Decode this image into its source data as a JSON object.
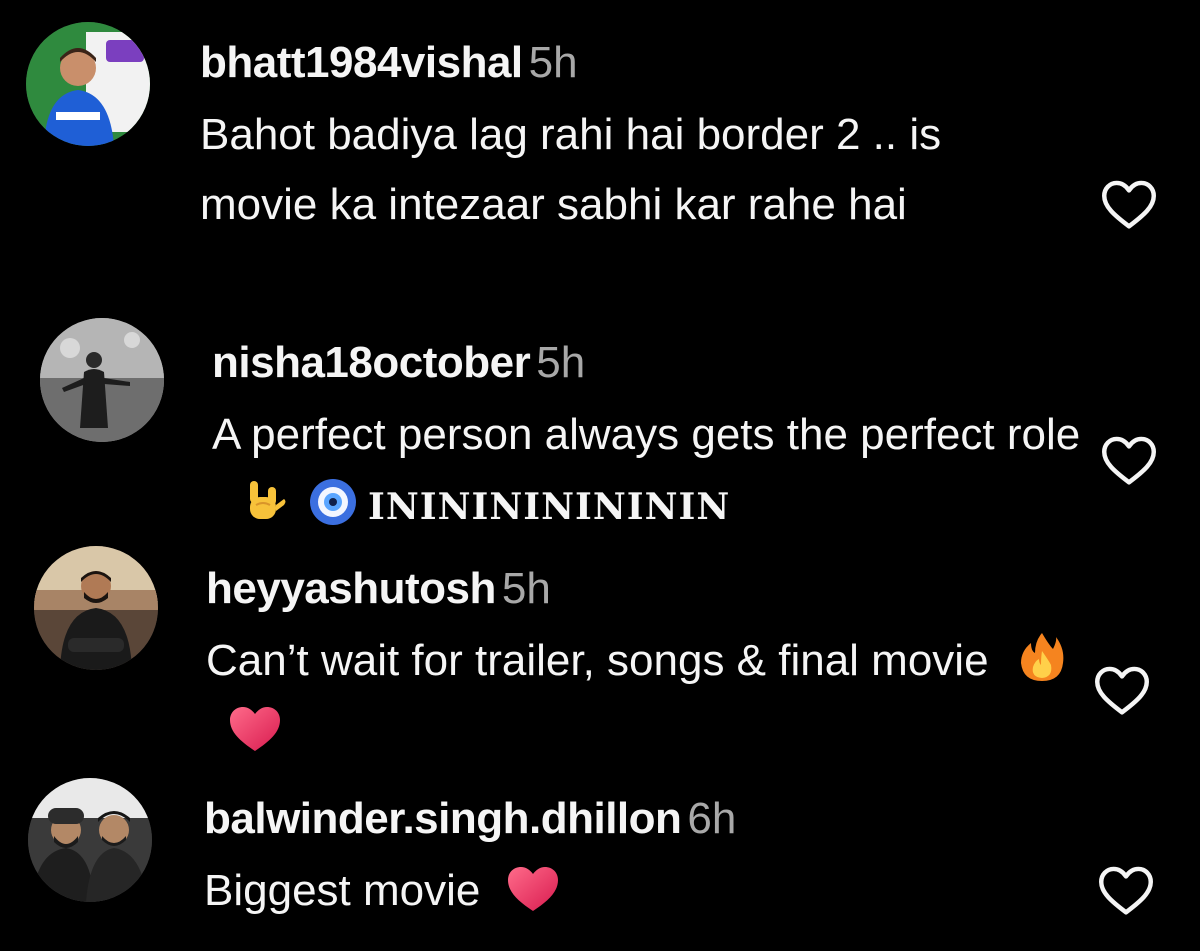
{
  "comments": [
    {
      "username": "bhatt1984vishal",
      "time": "5h",
      "text": "Bahot badiya lag rahi hai border 2 .. is movie ka intezaar sabhi kar rahe hai"
    },
    {
      "username": "nisha18october",
      "time": "5h",
      "text": "A perfect person always gets the perfect role",
      "emoji": [
        "sign-of-the-horns-emoji",
        "nazar-amulet-emoji"
      ],
      "tail": "INININININININ"
    },
    {
      "username": "heyyashutosh",
      "time": "5h",
      "text": "Can’t wait for trailer, songs & final movie",
      "emoji": [
        "fire-emoji",
        "heart-emoji"
      ]
    },
    {
      "username": "balwinder.singh.dhillon",
      "time": "6h",
      "text": "Biggest movie",
      "emoji": [
        "heart-emoji"
      ]
    }
  ],
  "colors": {
    "background": "#000000",
    "text": "#f5f5f5",
    "muted": "#a8a8a8"
  },
  "icons": {
    "like": "heart-outline-icon"
  }
}
